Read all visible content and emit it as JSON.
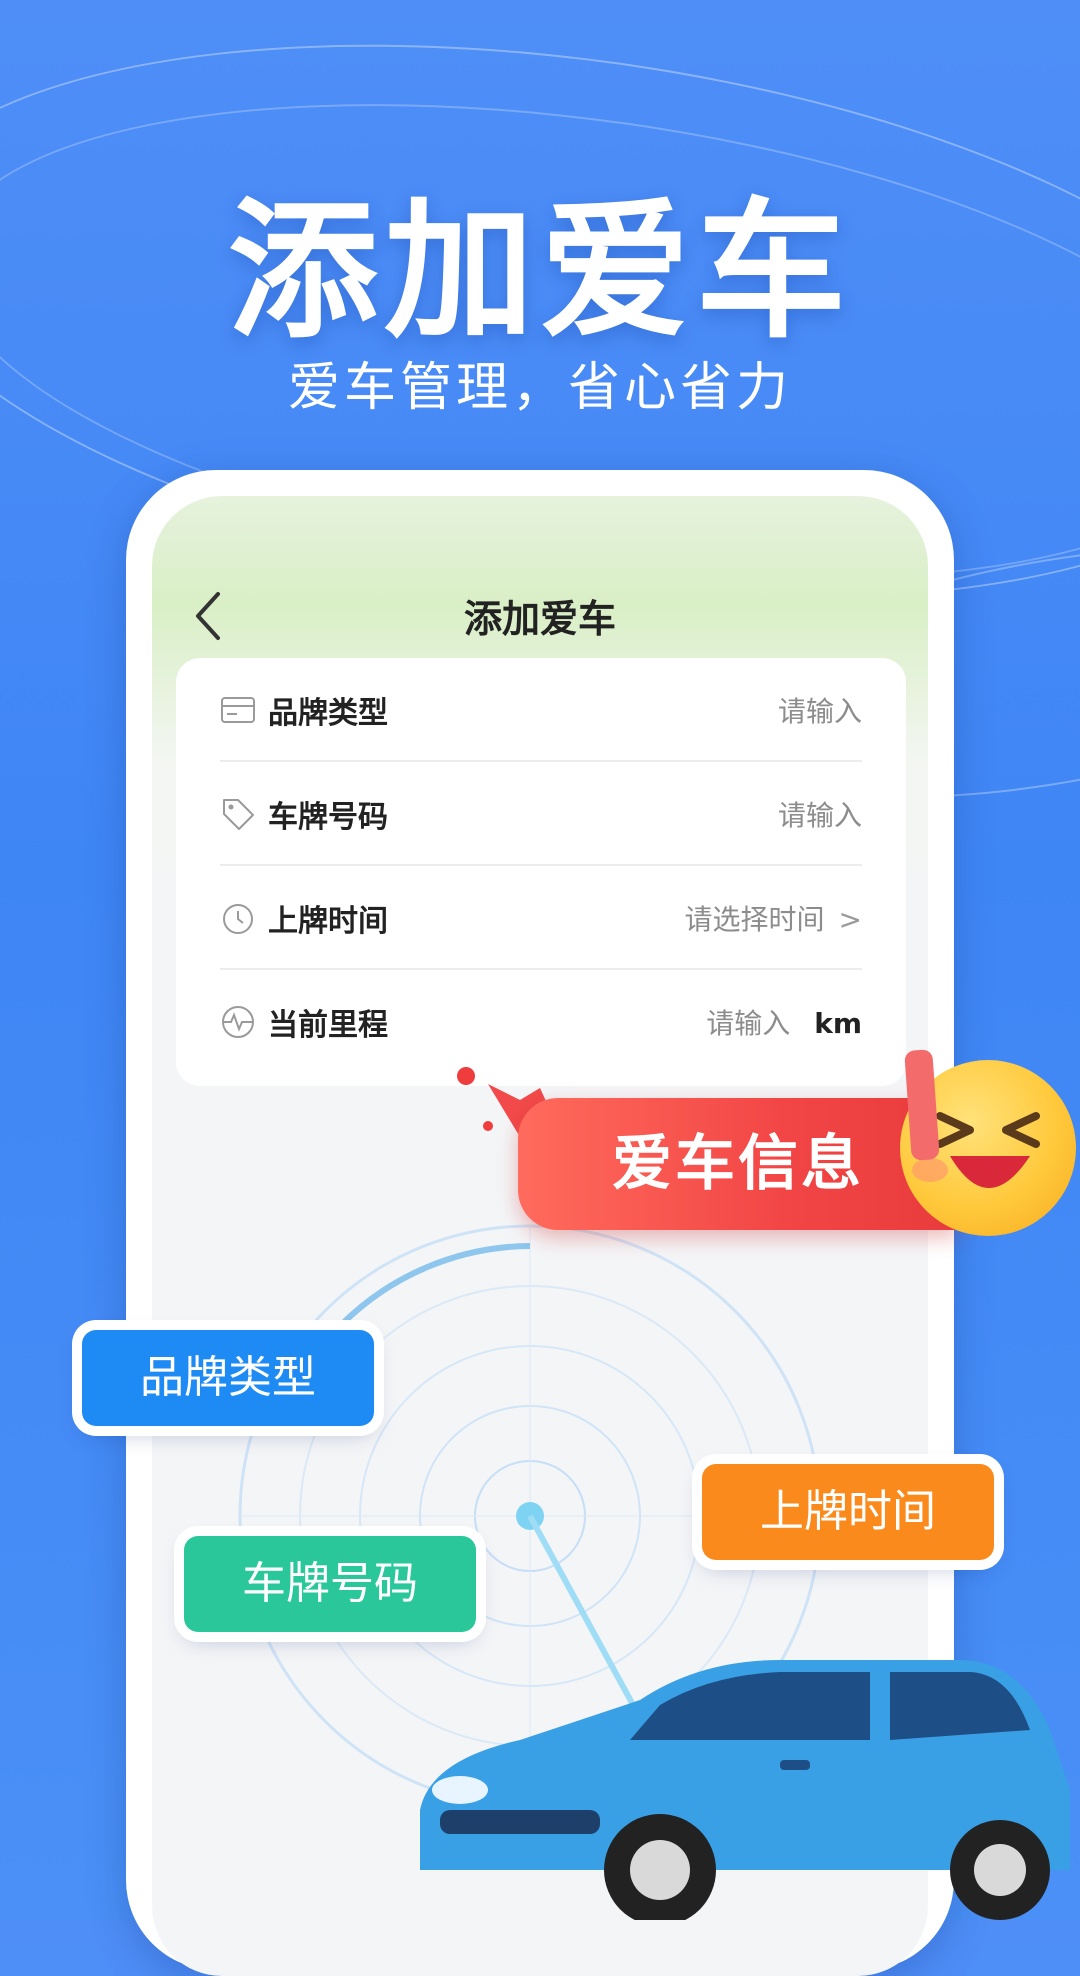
{
  "hero": {
    "title": "添加爱车",
    "subtitle": "爱车管理，省心省力"
  },
  "screen": {
    "title": "添加爱车",
    "form": [
      {
        "icon": "card-icon",
        "label": "品牌类型",
        "value": "请输入"
      },
      {
        "icon": "tag-icon",
        "label": "车牌号码",
        "value": "请输入"
      },
      {
        "icon": "clock-icon",
        "label": "上牌时间",
        "value": "请选择时间",
        "chevron": ">"
      },
      {
        "icon": "pulse-icon",
        "label": "当前里程",
        "value": "请输入",
        "unit": "km"
      }
    ]
  },
  "banner": {
    "label": "爱车信息"
  },
  "tags": {
    "brand": "品牌类型",
    "plate": "车牌号码",
    "date": "上牌时间"
  },
  "colors": {
    "background": "#4f8ef7",
    "banner": "#f24646",
    "tag_brand": "#1e8bf5",
    "tag_plate": "#29c79a",
    "tag_date": "#fb8a1c"
  }
}
